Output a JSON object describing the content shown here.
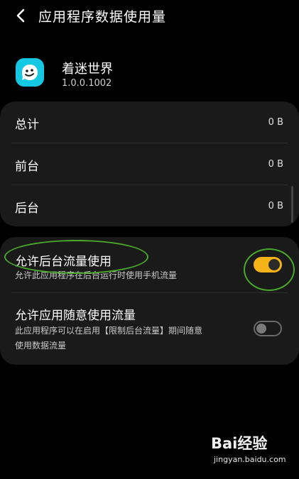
{
  "header": {
    "title": "应用程序数据使用量"
  },
  "app": {
    "name": "着迷世界",
    "version": "1.0.0.1002",
    "icon": "smiley-chat-icon",
    "icon_color": "#14c8e3"
  },
  "usage": {
    "rows": [
      {
        "label": "总计",
        "value": "0 B"
      },
      {
        "label": "前台",
        "value": "0 B"
      },
      {
        "label": "后台",
        "value": "0 B"
      }
    ]
  },
  "options": [
    {
      "title": "允许后台流量使用",
      "desc": "允许此应用程序在后台运行时使用手机流量",
      "enabled": true
    },
    {
      "title": "允许应用随意使用流量",
      "desc_line1": "此应用程序可以在启用【限制后台流量】期间随意",
      "desc_line2": "使用数据流量",
      "enabled": false
    }
  ],
  "colors": {
    "accent": "#f5b318",
    "card": "#1a1a1a",
    "annotation": "#4aa82a"
  },
  "watermark": {
    "main": "Bai经验",
    "sub": "jingyan.baidu.com"
  }
}
